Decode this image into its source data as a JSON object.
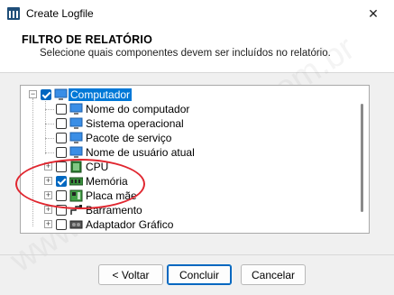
{
  "window": {
    "title": "Create Logfile",
    "close_glyph": "✕"
  },
  "header": {
    "title": "FILTRO DE RELATÓRIO",
    "subtitle": "Selecione quais componentes devem ser incluídos no relatório."
  },
  "tree": {
    "root": {
      "label": "Computador",
      "checked": true,
      "selected": true,
      "expanded": true,
      "icon": "computer-icon"
    },
    "items": [
      {
        "label": "Nome do computador",
        "checked": false,
        "icon": "monitor-icon"
      },
      {
        "label": "Sistema operacional",
        "checked": false,
        "icon": "monitor-icon"
      },
      {
        "label": "Pacote de serviço",
        "checked": false,
        "icon": "monitor-icon"
      },
      {
        "label": "Nome de usuário atual",
        "checked": false,
        "icon": "monitor-icon"
      },
      {
        "label": "CPU",
        "checked": false,
        "icon": "cpu-chip-icon",
        "expandable": true
      },
      {
        "label": "Memória",
        "checked": true,
        "icon": "memory-module-icon",
        "expandable": true
      },
      {
        "label": "Placa mãe",
        "checked": false,
        "icon": "motherboard-icon",
        "expandable": true
      },
      {
        "label": "Barramento",
        "checked": false,
        "icon": "bus-icon",
        "expandable": true
      },
      {
        "label": "Adaptador Gráfico",
        "checked": false,
        "icon": "graphics-adapter-icon",
        "expandable": true
      }
    ]
  },
  "buttons": {
    "back": "< Voltar",
    "finish": "Concluir",
    "cancel": "Cancelar"
  },
  "watermark": "www.suportutoriais.com.br",
  "colors": {
    "accent": "#0067c0",
    "annotation": "#e0262f"
  }
}
